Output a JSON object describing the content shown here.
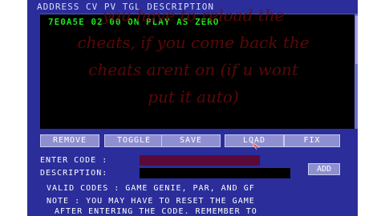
{
  "header": {
    "columns": "ADDRESS CV PV TGL DESCRIPTION"
  },
  "list": {
    "rows": [
      {
        "text": "7E0A5E 02 00 ON  PLAY AS ZERO"
      }
    ]
  },
  "overlay_caption": {
    "lines": [
      "you have to reload the",
      "cheats, if you come back the",
      "cheats arent on (if u wont",
      "put it auto)"
    ]
  },
  "buttons": {
    "remove": "REMOVE",
    "toggle": "TOGGLE",
    "save": "SAVE",
    "load": "LOAD",
    "fix": "FIX",
    "add": "ADD"
  },
  "form": {
    "enter_code_label": "ENTER CODE :",
    "description_label": "DESCRIPTION:",
    "enter_code_value": "",
    "description_value": ""
  },
  "info": {
    "valid_codes": "VALID CODES : GAME GENIE, PAR, AND GF",
    "note_line1": "NOTE : YOU MAY HAVE TO RESET THE GAME",
    "note_line2": "AFTER ENTERING THE CODE. REMEMBER TO"
  },
  "colors": {
    "panel": "#2a2d9a",
    "list_text": "#1ee21e",
    "code_field": "#5a0a3a",
    "overlay_text": "#6b0a0a"
  },
  "icons": {
    "cursor": "pointer-cursor-icon"
  }
}
